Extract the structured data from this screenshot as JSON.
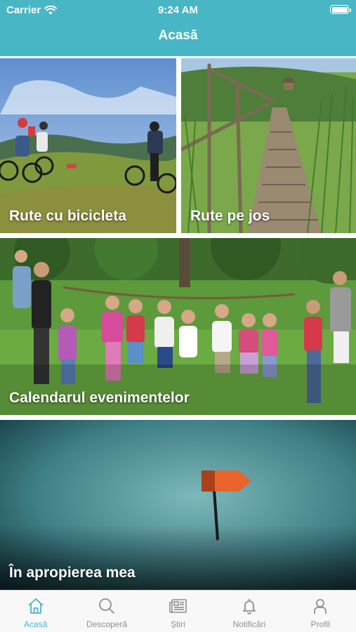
{
  "status_bar": {
    "carrier": "Carrier",
    "time": "9:24 AM"
  },
  "header": {
    "title": "Acasă",
    "color": "#48b6c4"
  },
  "tiles": [
    {
      "label": "Rute cu bicicleta",
      "image": "mountain-bikers-photo"
    },
    {
      "label": "Rute pe jos",
      "image": "wooden-boardwalk-photo"
    },
    {
      "label": "Calendarul evenimentelor",
      "image": "children-playing-outdoors-photo"
    },
    {
      "label": "În apropierea mea",
      "image": "map-pin-flag-photo"
    }
  ],
  "tabbar": {
    "active_color": "#48b6c4",
    "inactive_color": "#8e8e93",
    "tabs": [
      {
        "label": "Acasă",
        "icon": "home-icon",
        "active": true
      },
      {
        "label": "Descoperă",
        "icon": "search-icon",
        "active": false
      },
      {
        "label": "Știri",
        "icon": "newspaper-icon",
        "active": false
      },
      {
        "label": "Notificări",
        "icon": "bell-icon",
        "active": false
      },
      {
        "label": "Profil",
        "icon": "person-icon",
        "active": false
      }
    ]
  }
}
